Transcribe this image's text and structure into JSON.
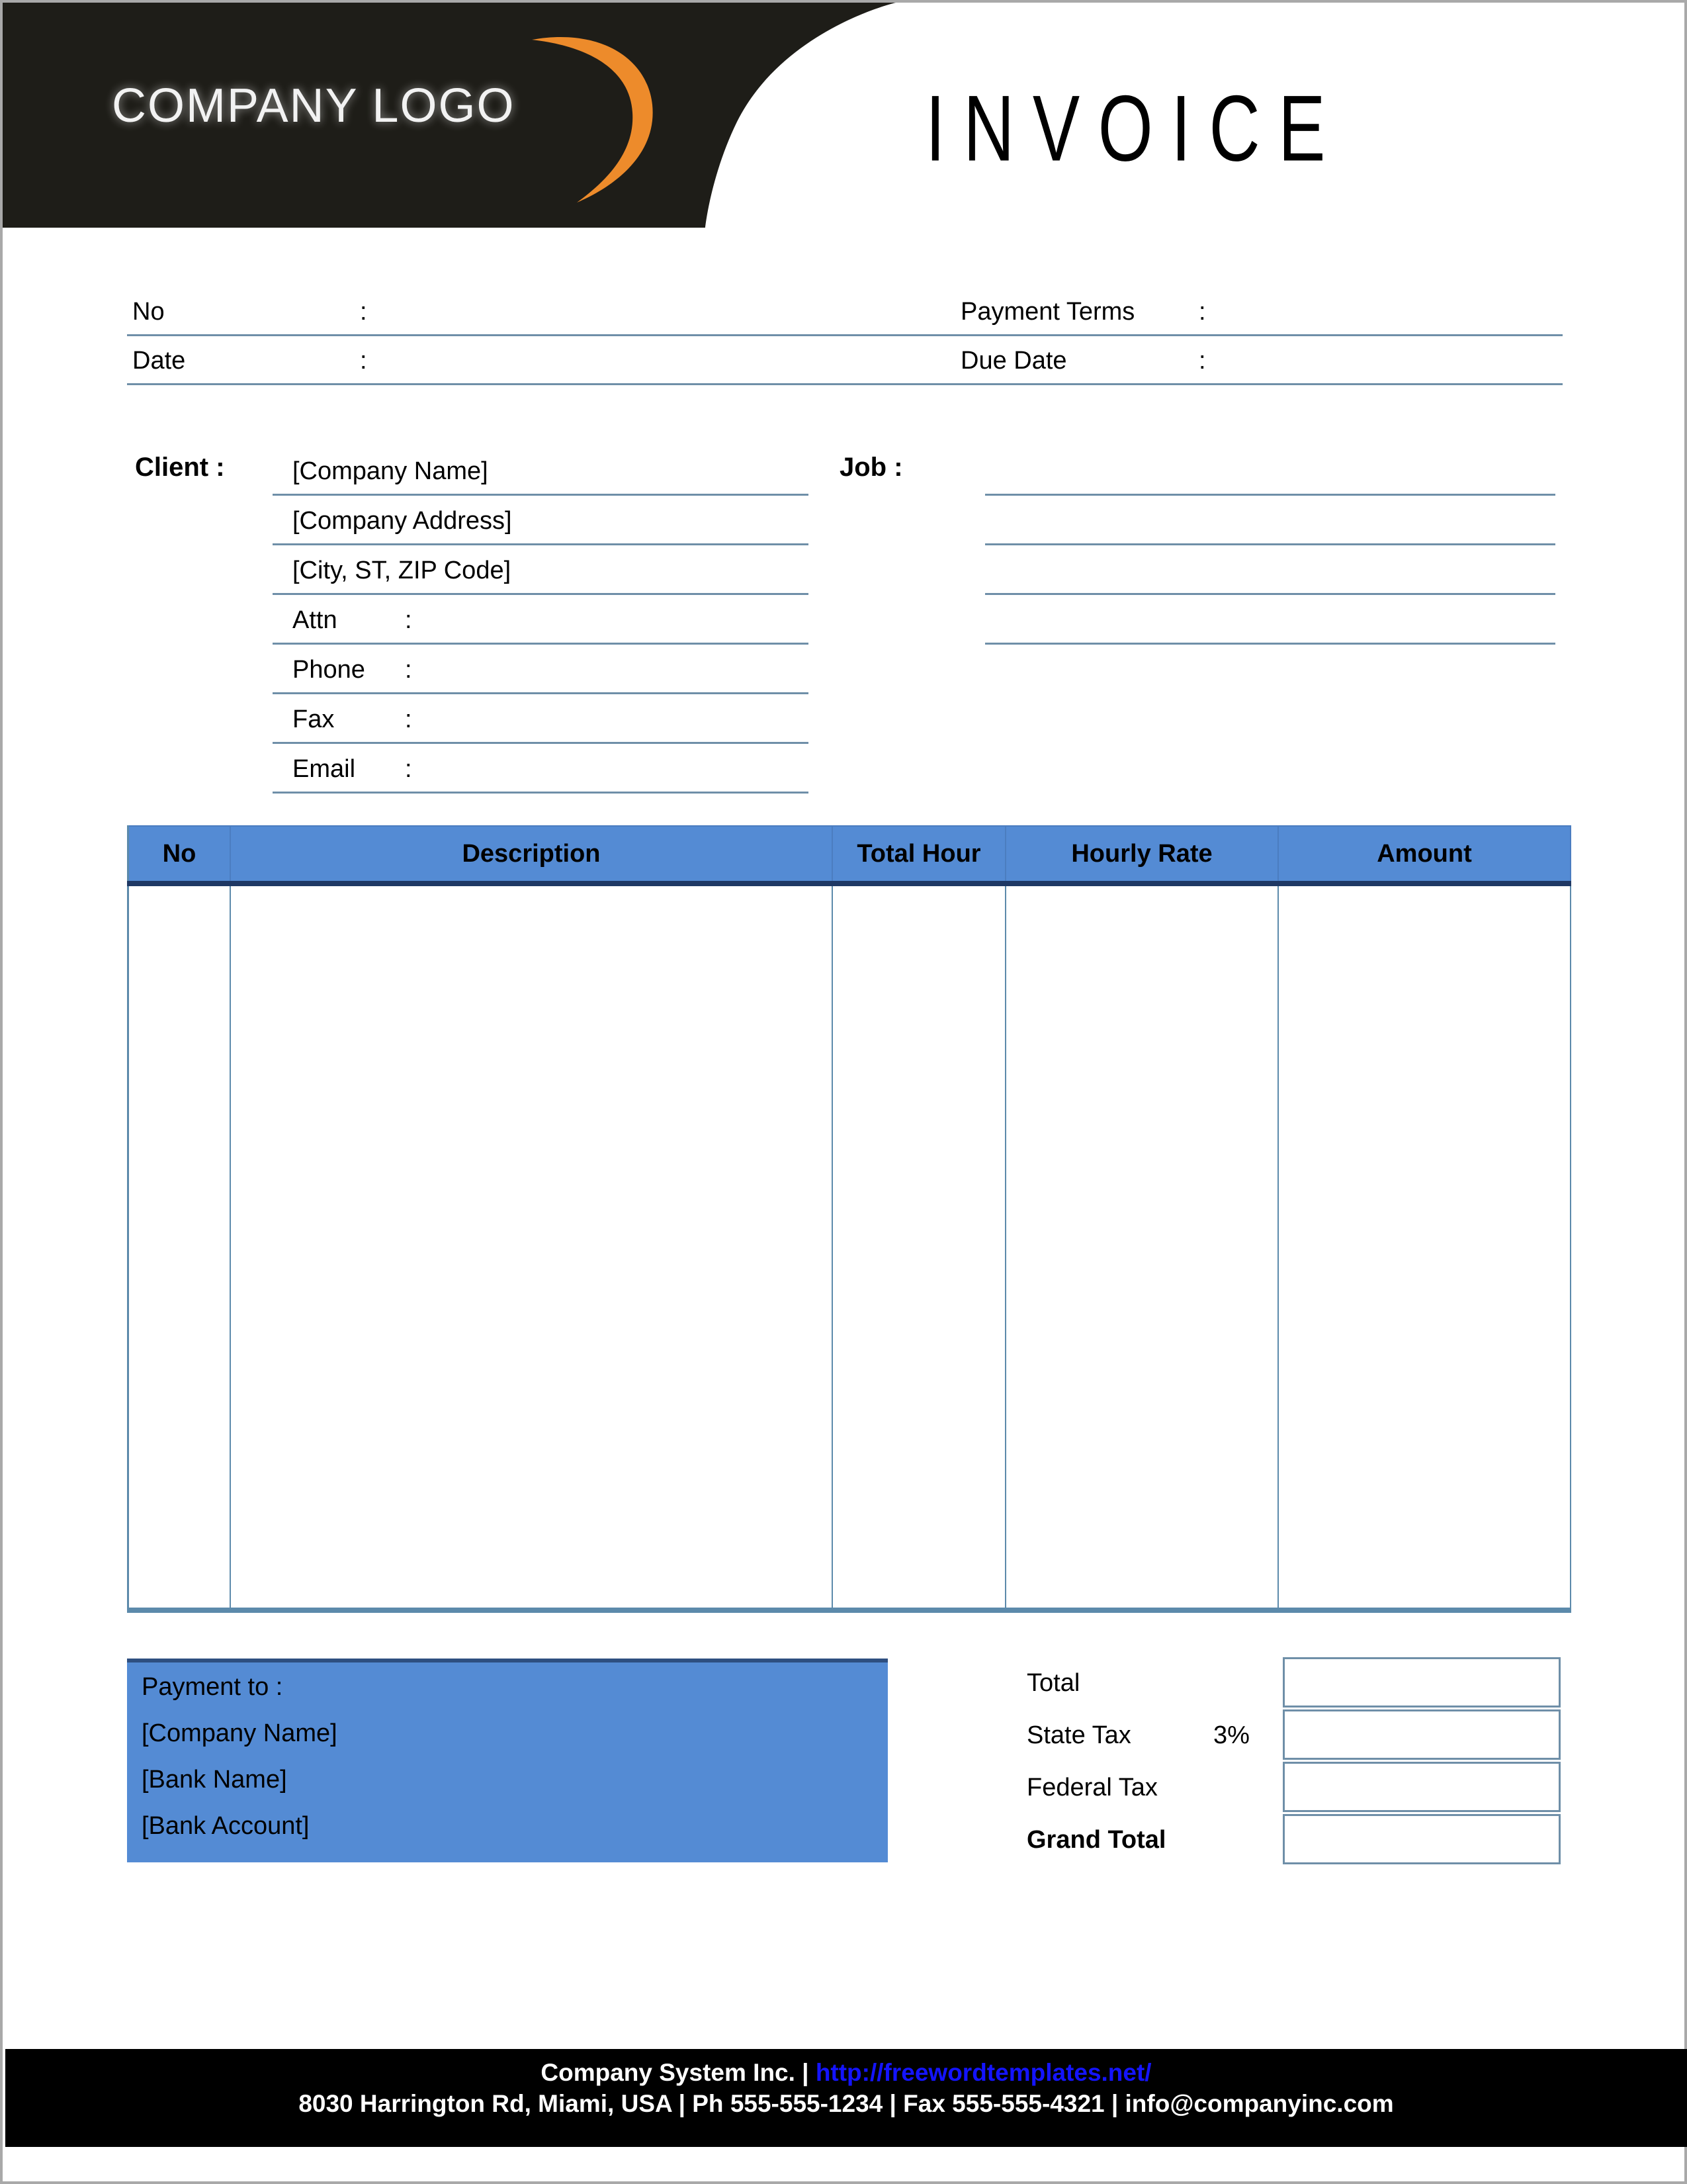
{
  "header": {
    "logo_text": "COMPANY LOGO",
    "logo_swoosh_color": "#ED8B2B",
    "banner_color": "#1E1D18",
    "title": "INVOICE"
  },
  "meta": {
    "no_label": "No",
    "no_colon": ":",
    "no_value": "",
    "date_label": "Date",
    "date_colon": ":",
    "date_value": "",
    "payment_terms_label": "Payment  Terms",
    "payment_terms_colon": ":",
    "payment_terms_value": "",
    "due_date_label": "Due Date",
    "due_date_colon": ":",
    "due_date_value": ""
  },
  "client": {
    "label": "Client  :",
    "rows": [
      {
        "text": "[Company Name]",
        "colon": "",
        "value": ""
      },
      {
        "text": "[Company Address]",
        "colon": "",
        "value": ""
      },
      {
        "text": "[City, ST, ZIP Code]",
        "colon": "",
        "value": ""
      },
      {
        "text": "Attn",
        "colon": ":",
        "value": ""
      },
      {
        "text": "Phone",
        "colon": ":",
        "value": ""
      },
      {
        "text": "Fax",
        "colon": ":",
        "value": ""
      },
      {
        "text": "Email",
        "colon": ":",
        "value": ""
      }
    ]
  },
  "job": {
    "label": "Job  :",
    "rows": [
      "",
      "",
      "",
      ""
    ]
  },
  "items_table": {
    "header_color": "#548BD4",
    "columns": [
      "No",
      "Description",
      "Total Hour",
      "Hourly Rate",
      "Amount"
    ],
    "rows": []
  },
  "payment_to": {
    "title": "Payment to :",
    "lines": [
      "[Company Name]",
      "[Bank Name]",
      "[Bank Account]"
    ],
    "background": "#548BD4"
  },
  "totals": {
    "rows": [
      {
        "label": "Total",
        "pct": "",
        "value": "",
        "bold": false
      },
      {
        "label": "State Tax",
        "pct": "3%",
        "value": "",
        "bold": false
      },
      {
        "label": "Federal Tax",
        "pct": "",
        "value": "",
        "bold": false
      },
      {
        "label": "Grand Total",
        "pct": "",
        "value": "",
        "bold": true
      }
    ]
  },
  "footer": {
    "line1_company": "Company System Inc. | ",
    "line1_url": "http://freewordtemplates.net/",
    "line2": "8030 Harrington Rd, Miami, USA | Ph 555-555-1234 | Fax 555-555-4321 | info@companyinc.com",
    "link_color": "#1414FF"
  }
}
